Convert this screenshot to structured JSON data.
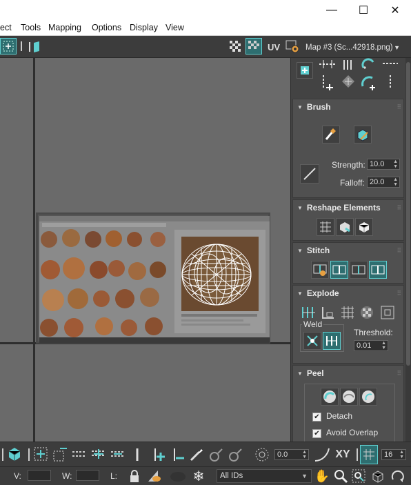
{
  "window": {
    "minimize": "—",
    "maximize": "☐",
    "close": "✕"
  },
  "menu": [
    "ect",
    "Tools",
    "Mapping",
    "Options",
    "Display",
    "View"
  ],
  "toolbar": {
    "uv_label": "UV",
    "map_dropdown": "Map #3 (Sc...42918.png)"
  },
  "brush": {
    "title": "Brush",
    "strength_label": "Strength:",
    "strength_value": "10.0",
    "falloff_label": "Falloff:",
    "falloff_value": "20.0"
  },
  "reshape": {
    "title": "Reshape Elements"
  },
  "stitch": {
    "title": "Stitch"
  },
  "explode": {
    "title": "Explode",
    "weld_label": "Weld",
    "threshold_label": "Threshold:",
    "threshold_value": "0.01"
  },
  "peel": {
    "title": "Peel",
    "detach_label": "Detach",
    "detach_checked": "✔",
    "avoid_overlap_label": "Avoid Overlap",
    "avoid_overlap_checked": "✔"
  },
  "bottom_toolbar": {
    "value_field": "0.0",
    "xy_label": "XY",
    "grid_value": "16"
  },
  "status": {
    "v_label": "V:",
    "w_label": "W:",
    "l_label": "L:",
    "ids_dropdown": "All IDs"
  },
  "colors": {
    "accent": "#5fcfd0",
    "panel": "#505050",
    "viewport": "#6a6a6a"
  }
}
